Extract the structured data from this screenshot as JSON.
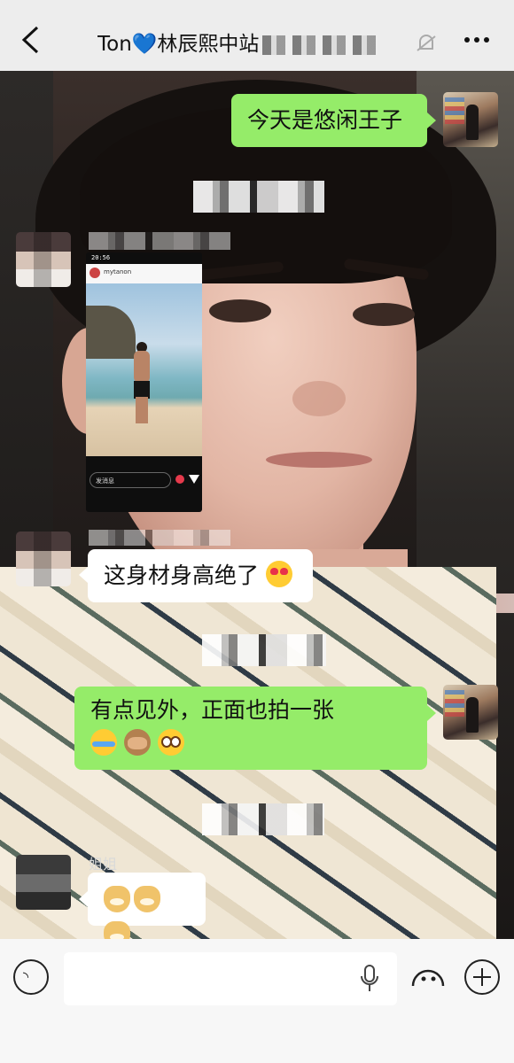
{
  "header": {
    "title": "Ton💙林辰熙中站",
    "back_label": "<"
  },
  "messages": [
    {
      "id": "m1",
      "side": "right",
      "text": "今天是悠闲王子"
    },
    {
      "id": "m2",
      "side": "left",
      "type": "image"
    },
    {
      "id": "m3",
      "side": "left",
      "text": "这身材身高绝了"
    },
    {
      "id": "m4",
      "side": "right",
      "text": "有点见外，正面也拍一张"
    },
    {
      "id": "m5",
      "side": "left",
      "sender": "姐姐",
      "text": ""
    }
  ],
  "shared_post": {
    "status_time": "20:56",
    "account": "mytanon",
    "comment_placeholder": "发消息"
  },
  "input_bar": {
    "icons": [
      "voice-icon",
      "mic-icon",
      "emoji-icon",
      "plus-icon"
    ]
  },
  "colors": {
    "bubble_self": "#95ec69",
    "bubble_other": "#ffffff",
    "header_bg": "#ededed"
  }
}
